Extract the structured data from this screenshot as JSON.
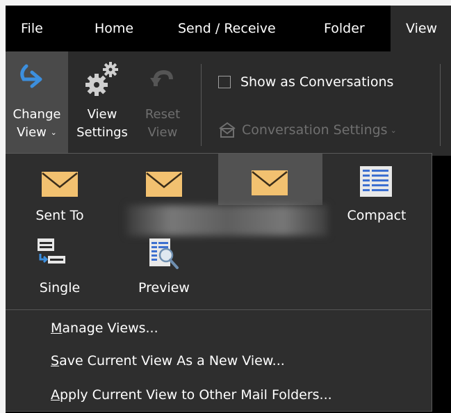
{
  "tabs": [
    {
      "label": "File"
    },
    {
      "label": "Home"
    },
    {
      "label": "Send / Receive"
    },
    {
      "label": "Folder"
    },
    {
      "label": "View"
    }
  ],
  "ribbon": {
    "change_view": {
      "line1": "Change",
      "line2": "View"
    },
    "view_settings": {
      "line1": "View",
      "line2": "Settings"
    },
    "reset_view": {
      "line1": "Reset",
      "line2": "View"
    },
    "show_as_conversations": {
      "label": "Show as Conversations",
      "checked": false
    },
    "conversation_settings": {
      "label": "Conversation Settings"
    }
  },
  "views": [
    {
      "label": "Sent To",
      "icon": "envelope-icon",
      "selected": false
    },
    {
      "label": "",
      "icon": "envelope-icon",
      "selected": false
    },
    {
      "label": "",
      "icon": "envelope-icon",
      "selected": true
    },
    {
      "label": "Compact",
      "icon": "compact-list-icon",
      "selected": false
    },
    {
      "label": "Single",
      "icon": "single-view-icon",
      "selected": false
    },
    {
      "label": "Preview",
      "icon": "preview-icon",
      "selected": false
    }
  ],
  "menu": [
    {
      "accel": "M",
      "rest": "anage Views..."
    },
    {
      "accel": "S",
      "rest": "ave Current View As a New View..."
    },
    {
      "accel": "A",
      "rest": "pply Current View to Other Mail Folders..."
    }
  ],
  "colors": {
    "envelope": "#f2c170",
    "accent_blue": "#3c8fde",
    "selected_bg": "#525252"
  }
}
